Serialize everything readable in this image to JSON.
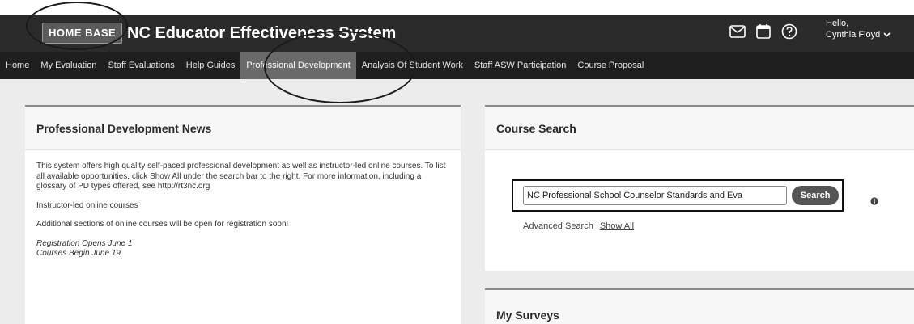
{
  "header": {
    "logo_text": "HOME BASE",
    "title": "NC Educator Effectiveness System",
    "icons": [
      "mail-icon",
      "calendar-icon",
      "help-icon"
    ],
    "greeting": "Hello,",
    "user_name": "Cynthia Floyd"
  },
  "nav": {
    "items": [
      {
        "label": "Home"
      },
      {
        "label": "My Evaluation"
      },
      {
        "label": "Staff Evaluations"
      },
      {
        "label": "Help Guides"
      },
      {
        "label": "Professional Development"
      },
      {
        "label": "Analysis Of Student Work"
      },
      {
        "label": "Staff ASW Participation"
      },
      {
        "label": "Course Proposal"
      }
    ],
    "active": "Professional Development"
  },
  "pd_news": {
    "title": "Professional Development News",
    "p1": "This system offers high quality self-paced professional development as well as instructor-led online courses. To list all available opportunities, click Show All under the search bar to the right. For more information, including a glossary of PD types offered, see http://rt3nc.org",
    "p2": "Instructor-led online courses",
    "p3": "Additional sections of online courses will be open for registration soon!",
    "p4": "Registration Opens June 1",
    "p5": "Courses Begin June 19"
  },
  "course_search": {
    "title": "Course Search",
    "input_value": "NC Professional School Counselor Standards and Eva",
    "search_label": "Search",
    "advanced_label": "Advanced Search",
    "show_all_label": "Show All"
  },
  "surveys": {
    "title": "My Surveys"
  }
}
